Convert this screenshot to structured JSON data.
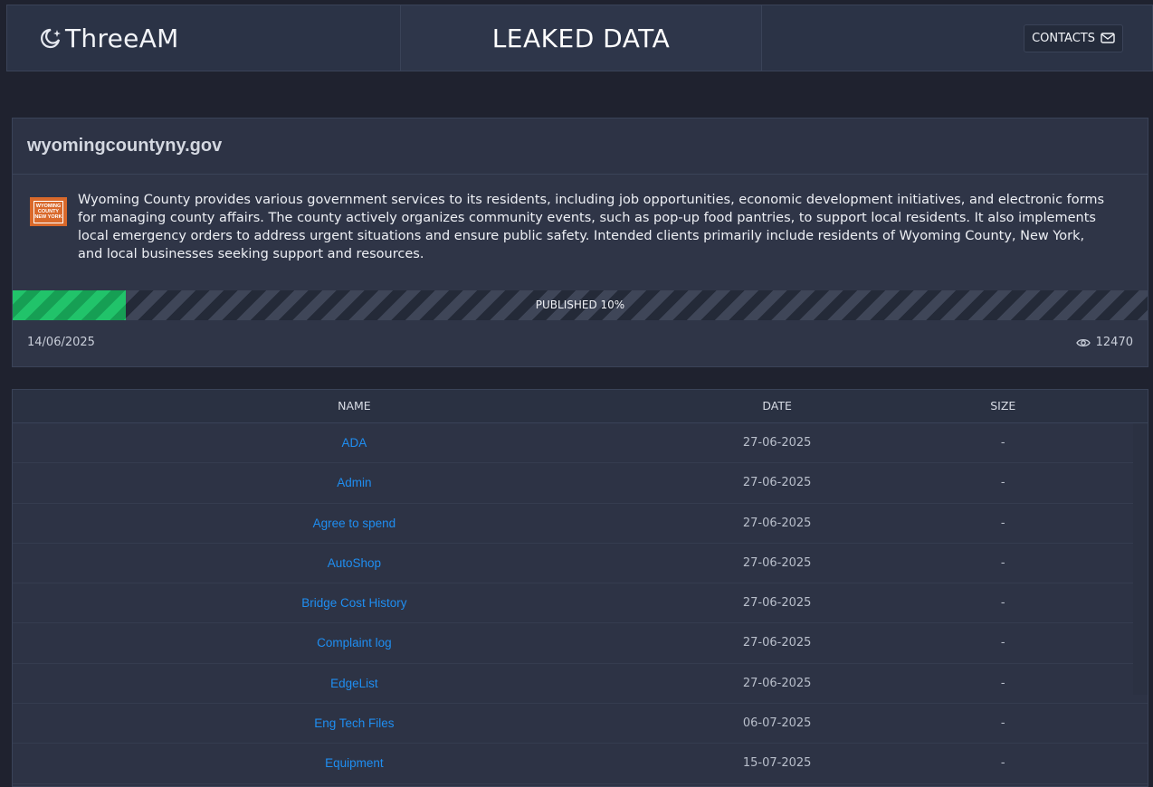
{
  "header": {
    "brand": "ThreeAM",
    "title": "LEAKED DATA",
    "contacts_label": "CONTACTS",
    "brand_icon": "moon-star-icon",
    "contacts_icon": "envelope-icon"
  },
  "victim": {
    "domain": "wyomingcountyny.gov",
    "logo_text": "WYOMING COUNTY NEW YORK",
    "description": "Wyoming County provides various government services to its residents, including job opportunities, economic development initiatives, and electronic forms for managing county affairs. The county actively organizes community events, such as pop-up food pantries, to support local residents. It also implements local emergency orders to address urgent situations and ensure public safety. Intended clients primarily include residents of Wyoming County, New York, and local businesses seeking support and resources.",
    "progress_label": "PUBLISHED 10%",
    "progress_percent": 10,
    "date": "14/06/2025",
    "views": "12470",
    "colors": {
      "progress_fill": "#21c36a",
      "link": "#1f8ef1",
      "logo_bg": "#d9692b"
    }
  },
  "files": {
    "columns": {
      "name": "NAME",
      "date": "DATE",
      "size": "SIZE"
    },
    "rows": [
      {
        "name": "ADA",
        "date": "27-06-2025",
        "size": "-"
      },
      {
        "name": "Admin",
        "date": "27-06-2025",
        "size": "-"
      },
      {
        "name": "Agree to spend",
        "date": "27-06-2025",
        "size": "-"
      },
      {
        "name": "AutoShop",
        "date": "27-06-2025",
        "size": "-"
      },
      {
        "name": "Bridge Cost History",
        "date": "27-06-2025",
        "size": "-"
      },
      {
        "name": "Complaint log",
        "date": "27-06-2025",
        "size": "-"
      },
      {
        "name": "EdgeList",
        "date": "27-06-2025",
        "size": "-"
      },
      {
        "name": "Eng Tech Files",
        "date": "06-07-2025",
        "size": "-"
      },
      {
        "name": "Equipment",
        "date": "15-07-2025",
        "size": "-"
      }
    ]
  }
}
